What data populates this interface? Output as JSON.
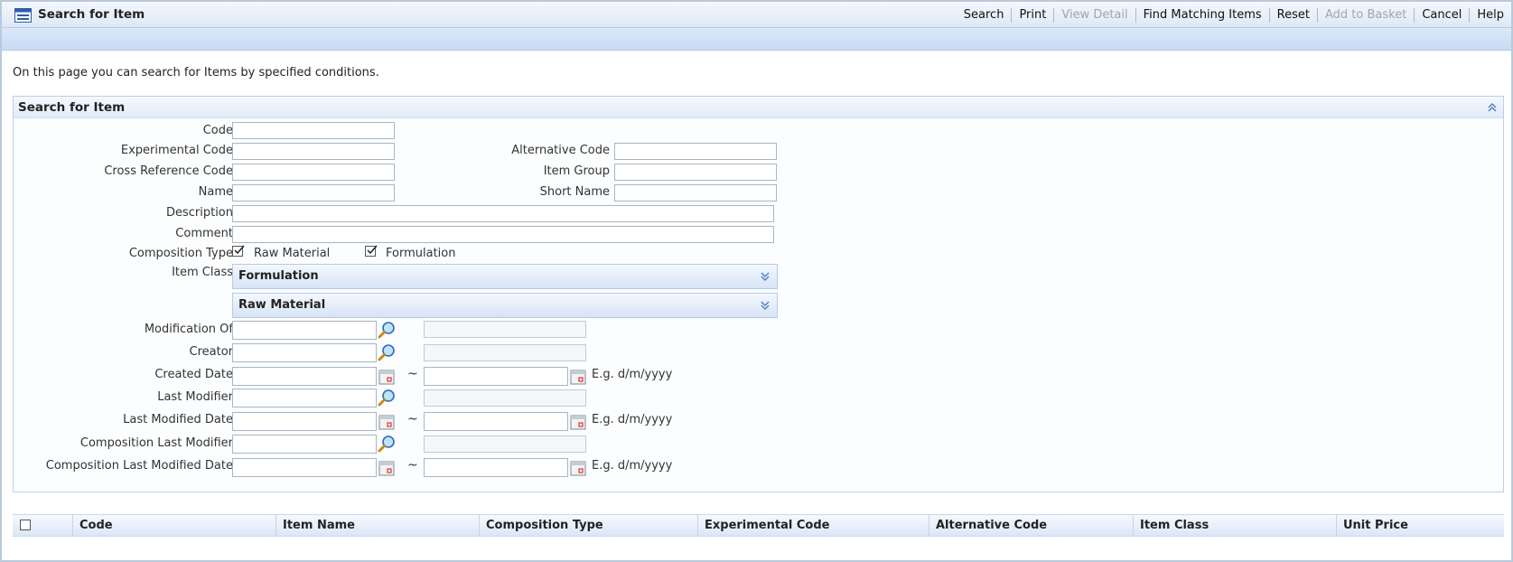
{
  "window": {
    "title": "Search for Item"
  },
  "toolbar": {
    "search": "Search",
    "print": "Print",
    "view_detail": "View Detail",
    "find_matching": "Find Matching Items",
    "reset": "Reset",
    "add_to_basket": "Add to Basket",
    "cancel": "Cancel",
    "help": "Help"
  },
  "intro": "On this page you can search for Items by specified conditions.",
  "panel": {
    "title": "Search for Item",
    "labels": {
      "code": "Code",
      "experimental_code": "Experimental Code",
      "alternative_code": "Alternative Code",
      "cross_reference_code": "Cross Reference Code",
      "item_group": "Item Group",
      "name": "Name",
      "short_name": "Short Name",
      "description": "Description",
      "comment": "Comment",
      "composition_type": "Composition Type",
      "item_class": "Item Class",
      "modification_of": "Modification Of",
      "creator": "Creator",
      "created_date": "Created Date",
      "last_modifier": "Last Modifier",
      "last_modified_date": "Last Modified Date",
      "composition_last_modifier": "Composition Last Modifier",
      "composition_last_modified_date": "Composition Last Modified Date"
    },
    "values": {
      "code": "",
      "experimental_code": "",
      "alternative_code": "",
      "cross_reference_code": "",
      "item_group": "",
      "name": "",
      "short_name": "",
      "description": "",
      "comment": ""
    },
    "composition_type": {
      "raw_material": {
        "label": "Raw Material",
        "checked": true
      },
      "formulation": {
        "label": "Formulation",
        "checked": true
      }
    },
    "item_class_sections": {
      "formulation": "Formulation",
      "raw_material": "Raw Material"
    },
    "range_separator": "~",
    "date_hint": "E.g. d/m/yyyy"
  },
  "results": {
    "columns": [
      "Code",
      "Item Name",
      "Composition Type",
      "Experimental Code",
      "Alternative Code",
      "Item Class",
      "Unit Price"
    ]
  }
}
